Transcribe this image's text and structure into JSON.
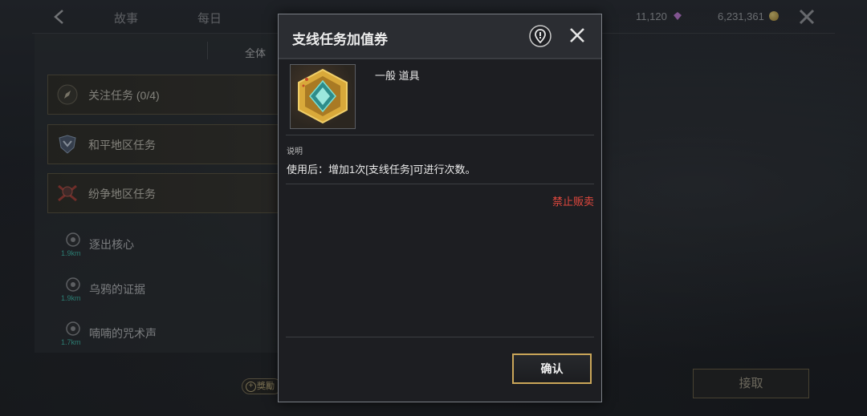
{
  "topbar": {
    "tabs": [
      "故事",
      "每日"
    ],
    "currency": {
      "gems": "11,120",
      "gold": "6,231,361"
    }
  },
  "left_panel": {
    "sub_tab": "全体",
    "categories": [
      {
        "label": "关注任务 (0/4)",
        "icon": "compass-icon"
      },
      {
        "label": "和平地区任务",
        "icon": "peace-emblem-icon"
      },
      {
        "label": "纷争地区任务",
        "icon": "conflict-emblem-icon"
      }
    ],
    "quests": [
      {
        "label": "逐出核心",
        "distance": "1.9km"
      },
      {
        "label": "乌鸦的证据",
        "distance": "1.9km"
      },
      {
        "label": "喃喃的咒术声",
        "distance": "1.7km"
      }
    ],
    "reward_label": "獎勵",
    "accept_label": "接取"
  },
  "dialog": {
    "title": "支线任务加值券",
    "item_type": "一般 道具",
    "desc_heading": "说明",
    "desc_text": "使用后：增加1次[支线任务]可进行次数。",
    "restriction": "禁止贩卖",
    "confirm_label": "确认"
  },
  "colors": {
    "restriction": "#e0483e",
    "confirm_border": "#caa659",
    "distance": "#3fb8a8"
  }
}
